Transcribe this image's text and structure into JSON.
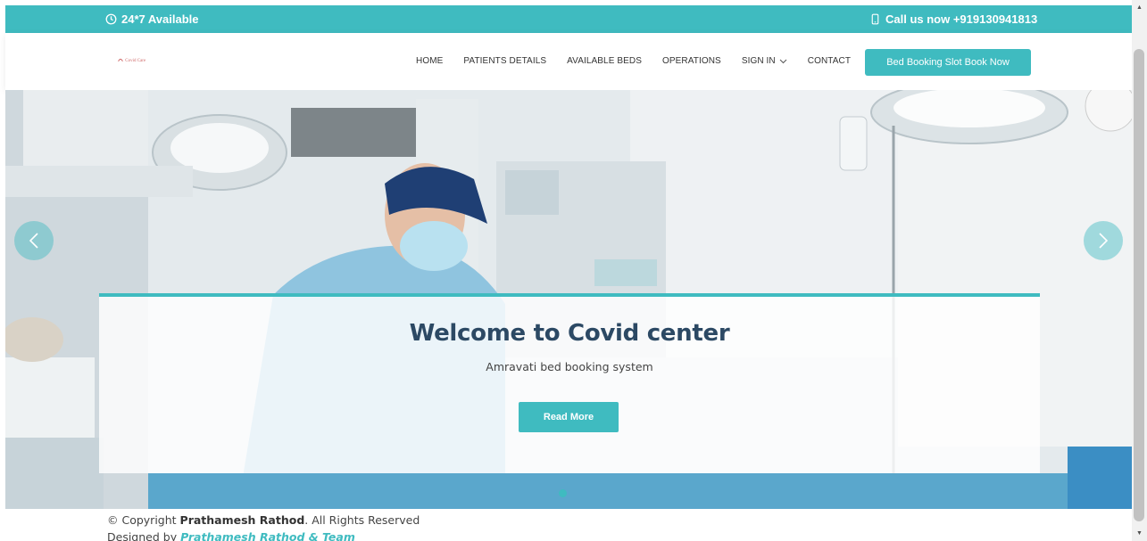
{
  "topbar": {
    "availability": "24*7 Available",
    "phone": "Call us now +919130941813",
    "clock_icon": "clock-icon",
    "phone_icon": "phone-icon"
  },
  "header": {
    "logo_text": "Covid Care",
    "nav": [
      "HOME",
      "PATIENTS DETAILS",
      "AVAILABLE BEDS",
      "OPERATIONS",
      "SIGN IN",
      "CONTACT"
    ],
    "book_button": "Bed Booking Slot Book Now"
  },
  "hero": {
    "title": "Welcome to Covid center",
    "subtitle": "Amravati bed booking system",
    "read_more": "Read More",
    "slide_count": 1,
    "active_slide": 1
  },
  "footer": {
    "copyright_prefix": "© Copyright ",
    "copyright_name": "Prathamesh Rathod",
    "copyright_suffix": ". All Rights Reserved",
    "designed_prefix": "Designed by ",
    "designed_by": "Prathamesh Rathod & Team"
  },
  "colors": {
    "accent": "#3fbbc0",
    "heading": "#2c4964"
  }
}
